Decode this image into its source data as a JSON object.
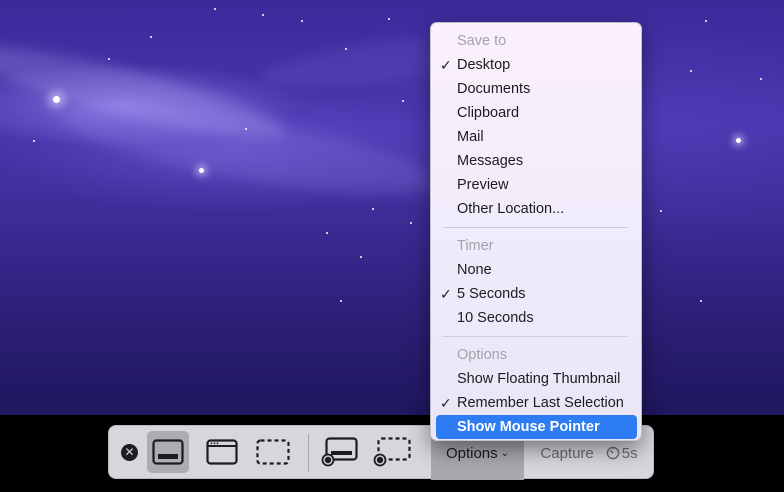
{
  "menu": {
    "save_to_header": "Save to",
    "save_to_items": [
      {
        "label": "Desktop",
        "checked": true
      },
      {
        "label": "Documents",
        "checked": false
      },
      {
        "label": "Clipboard",
        "checked": false
      },
      {
        "label": "Mail",
        "checked": false
      },
      {
        "label": "Messages",
        "checked": false
      },
      {
        "label": "Preview",
        "checked": false
      },
      {
        "label": "Other Location...",
        "checked": false
      }
    ],
    "timer_header": "Timer",
    "timer_items": [
      {
        "label": "None",
        "checked": false
      },
      {
        "label": "5 Seconds",
        "checked": true
      },
      {
        "label": "10 Seconds",
        "checked": false
      }
    ],
    "options_header": "Options",
    "options_items": [
      {
        "label": "Show Floating Thumbnail",
        "checked": false
      },
      {
        "label": "Remember Last Selection",
        "checked": true
      },
      {
        "label": "Show Mouse Pointer",
        "checked": false,
        "highlighted": true
      }
    ],
    "check_glyph": "✓"
  },
  "toolbar": {
    "close_glyph": "✕",
    "tools": [
      {
        "name": "capture-entire-screen",
        "icon": "screen-icon",
        "selected": true
      },
      {
        "name": "capture-window",
        "icon": "window-icon",
        "selected": false
      },
      {
        "name": "capture-selection",
        "icon": "selection-icon",
        "selected": false
      },
      {
        "name": "record-entire-screen",
        "icon": "record-screen-icon",
        "selected": false
      },
      {
        "name": "record-selection",
        "icon": "record-selection-icon",
        "selected": false
      }
    ],
    "options_label": "Options",
    "options_chevron": "⌄",
    "capture_label": "Capture",
    "timer_label": "5s"
  },
  "colors": {
    "highlight": "#2d7cf3",
    "toolbar_bg": "#d8d6dc",
    "header_text": "#a4a2ab"
  }
}
